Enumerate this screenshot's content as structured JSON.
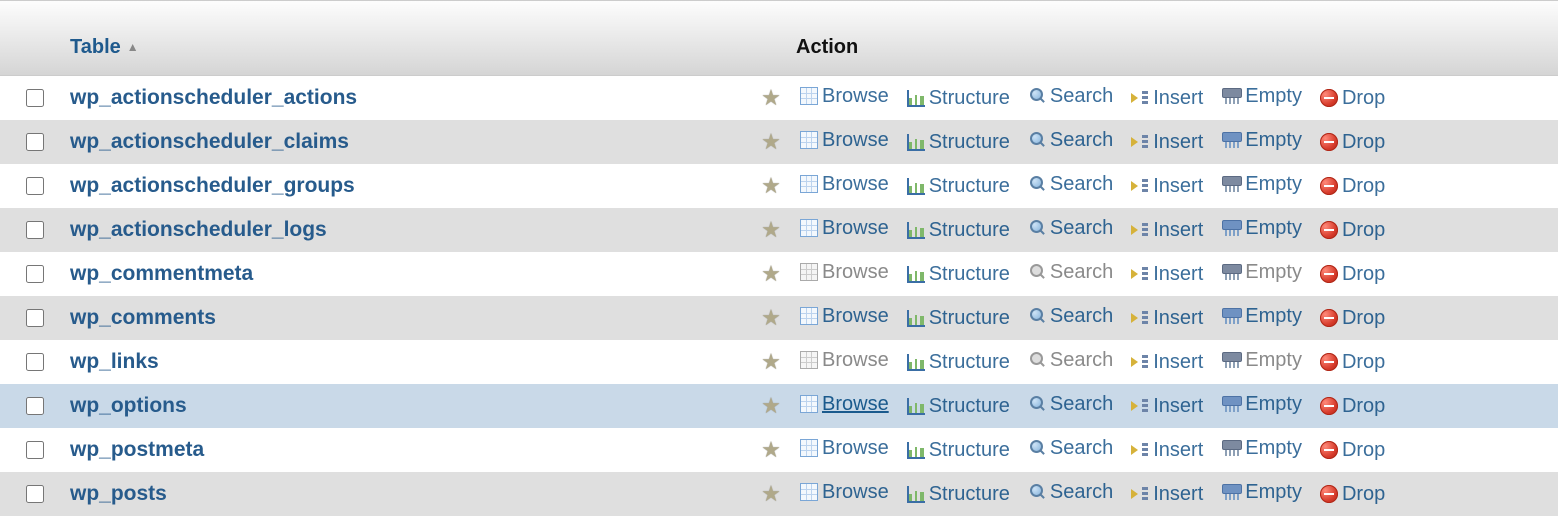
{
  "header": {
    "table_label": "Table",
    "action_label": "Action"
  },
  "actions": {
    "browse": "Browse",
    "structure": "Structure",
    "search": "Search",
    "insert": "Insert",
    "empty": "Empty",
    "drop": "Drop"
  },
  "tables": [
    {
      "name": "wp_actionscheduler_actions",
      "populated": true,
      "hover": false
    },
    {
      "name": "wp_actionscheduler_claims",
      "populated": true,
      "hover": false
    },
    {
      "name": "wp_actionscheduler_groups",
      "populated": true,
      "hover": false
    },
    {
      "name": "wp_actionscheduler_logs",
      "populated": true,
      "hover": false
    },
    {
      "name": "wp_commentmeta",
      "populated": false,
      "hover": false
    },
    {
      "name": "wp_comments",
      "populated": true,
      "hover": false
    },
    {
      "name": "wp_links",
      "populated": false,
      "hover": false
    },
    {
      "name": "wp_options",
      "populated": true,
      "hover": true
    },
    {
      "name": "wp_postmeta",
      "populated": true,
      "hover": false
    },
    {
      "name": "wp_posts",
      "populated": true,
      "hover": false
    }
  ]
}
